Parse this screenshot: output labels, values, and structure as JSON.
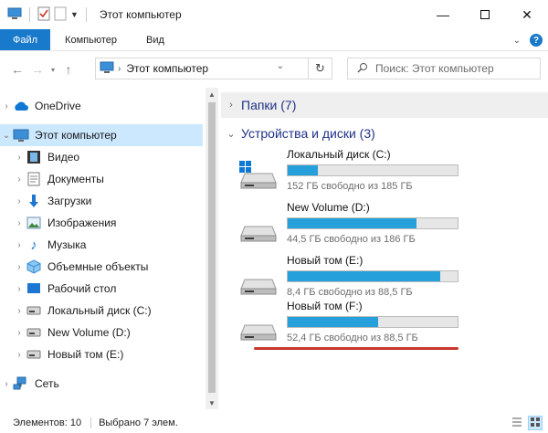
{
  "window": {
    "title": "Этот компьютер"
  },
  "ribbon": {
    "tabs": [
      "Файл",
      "Компьютер",
      "Вид"
    ]
  },
  "address": {
    "path": "Этот компьютер",
    "search_placeholder": "Поиск: Этот компьютер"
  },
  "nav": {
    "items": [
      {
        "label": "OneDrive",
        "icon": "cloud-icon"
      },
      {
        "label": "Этот компьютер",
        "icon": "computer-icon"
      },
      {
        "label": "Видео",
        "icon": "video-icon"
      },
      {
        "label": "Документы",
        "icon": "documents-icon"
      },
      {
        "label": "Загрузки",
        "icon": "downloads-icon"
      },
      {
        "label": "Изображения",
        "icon": "pictures-icon"
      },
      {
        "label": "Музыка",
        "icon": "music-icon"
      },
      {
        "label": "Объемные объекты",
        "icon": "3d-objects-icon"
      },
      {
        "label": "Рабочий стол",
        "icon": "desktop-icon"
      },
      {
        "label": "Локальный диск (C:)",
        "icon": "drive-icon"
      },
      {
        "label": "New Volume (D:)",
        "icon": "drive-icon"
      },
      {
        "label": "Новый том (E:)",
        "icon": "drive-icon"
      },
      {
        "label": "Сеть",
        "icon": "network-icon"
      }
    ]
  },
  "content": {
    "folders_group": "Папки (7)",
    "drives_group": "Устройства и диски (3)",
    "drives": [
      {
        "name": "Локальный диск (C:)",
        "free_text": "152 ГБ свободно из 185 ГБ",
        "used_fraction": 0.18
      },
      {
        "name": "New Volume (D:)",
        "free_text": "44,5 ГБ свободно из 186 ГБ",
        "used_fraction": 0.76
      },
      {
        "name": "Новый том (E:)",
        "free_text": "8,4 ГБ свободно из 88,5 ГБ",
        "used_fraction": 0.9
      },
      {
        "name": "Новый том (F:)",
        "free_text": "52,4 ГБ свободно из 88,5 ГБ",
        "used_fraction": 0.53
      }
    ]
  },
  "status": {
    "count": "Элементов: 10",
    "selected": "Выбрано 7 элем."
  },
  "colors": {
    "accent": "#1979ca",
    "bar": "#26a0da",
    "underline": "#c8372a",
    "selected_bg": "#cce8ff"
  }
}
